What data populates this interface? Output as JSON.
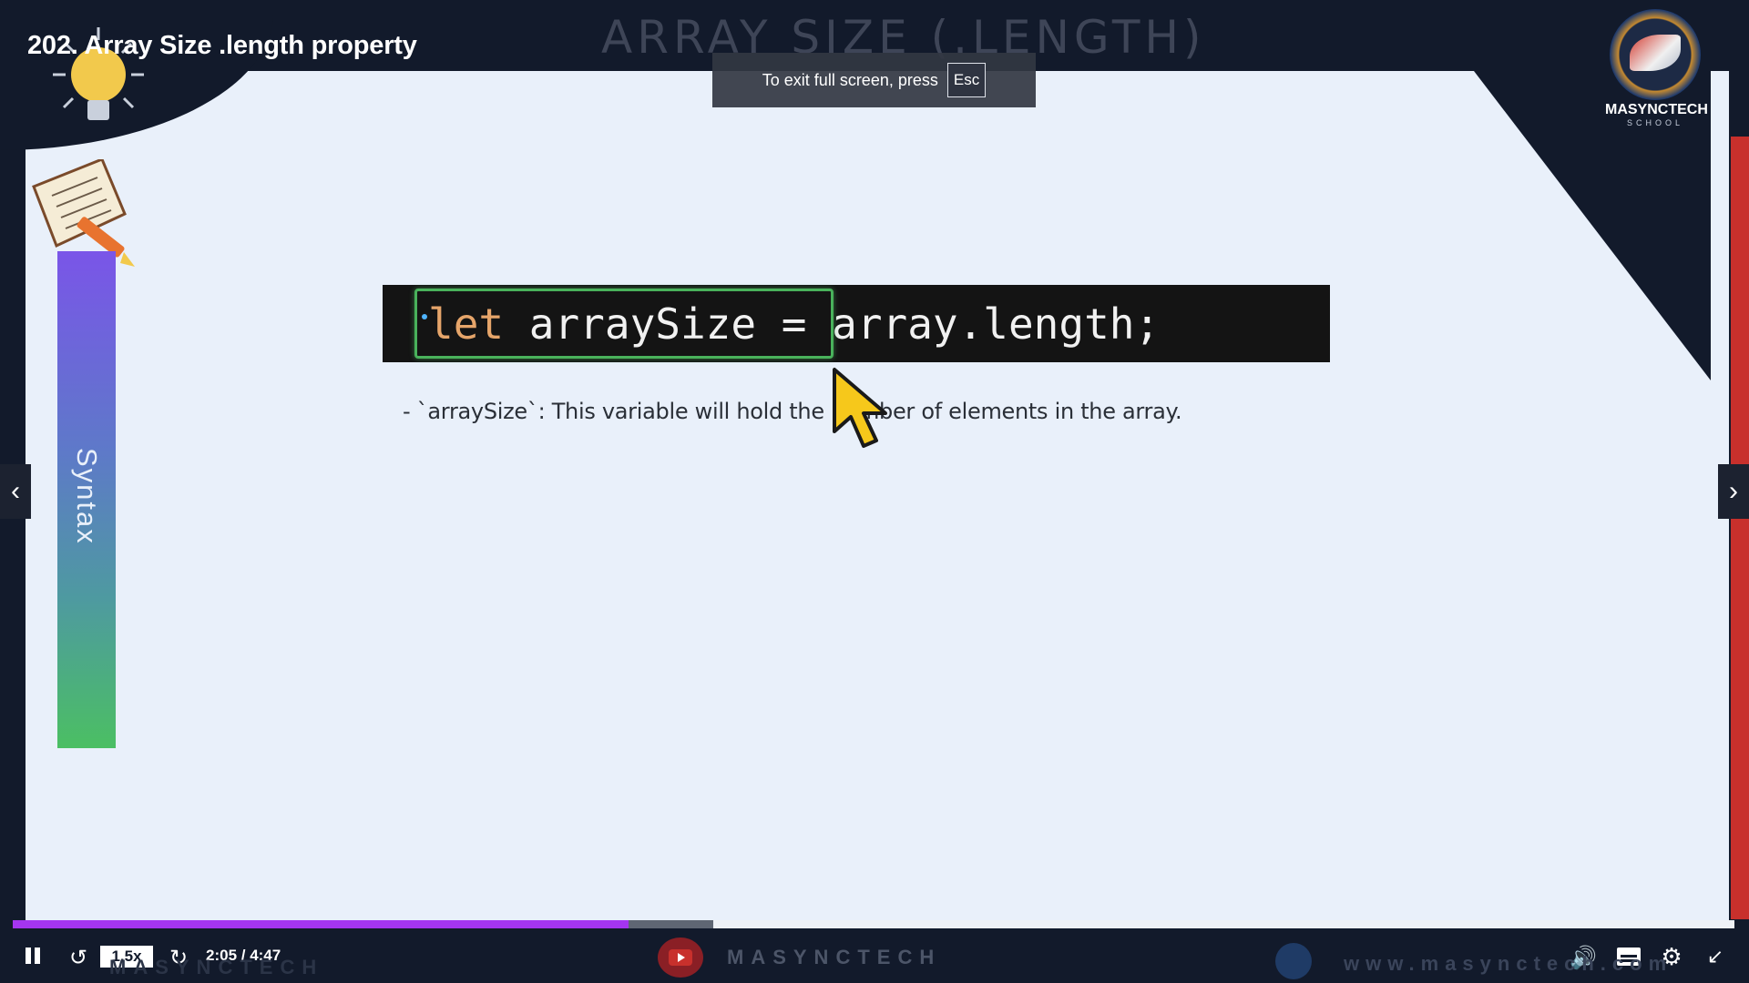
{
  "video": {
    "title": "202. Array Size .length property",
    "slide_heading": "ARRAY SIZE (.LENGTH)"
  },
  "toast": {
    "message": "To exit full screen, press",
    "key": "Esc"
  },
  "logo": {
    "name": "MASYNCTECH",
    "sub": "SCHOOL"
  },
  "slide": {
    "side_label": "Syntax",
    "code": {
      "keyword": "let",
      "var": " arraySize",
      "rest": " = array.length;"
    },
    "note": "- `arraySize`: This variable will hold the number of elements in the array."
  },
  "player": {
    "progress_fraction": 0.436,
    "buffered_fraction": 0.407,
    "speed": "1.5x",
    "time": "2:05 / 4:47",
    "brand": "MASYNCTECH",
    "url": "www.masynctech.com"
  },
  "icons": {
    "pause": "pause-icon",
    "rewind": "rewind-icon",
    "forward": "forward-icon",
    "volume": "volume-icon",
    "captions": "captions-icon",
    "settings": "gear-icon",
    "exit_fullscreen": "exit-fullscreen-icon",
    "prev": "chevron-left-icon",
    "next": "chevron-right-icon"
  },
  "colors": {
    "accent": "#a435f0",
    "frame": "#121a2b",
    "slide_bg": "#e9f0fa",
    "code_bg": "#141414",
    "highlight": "#49b25b"
  }
}
